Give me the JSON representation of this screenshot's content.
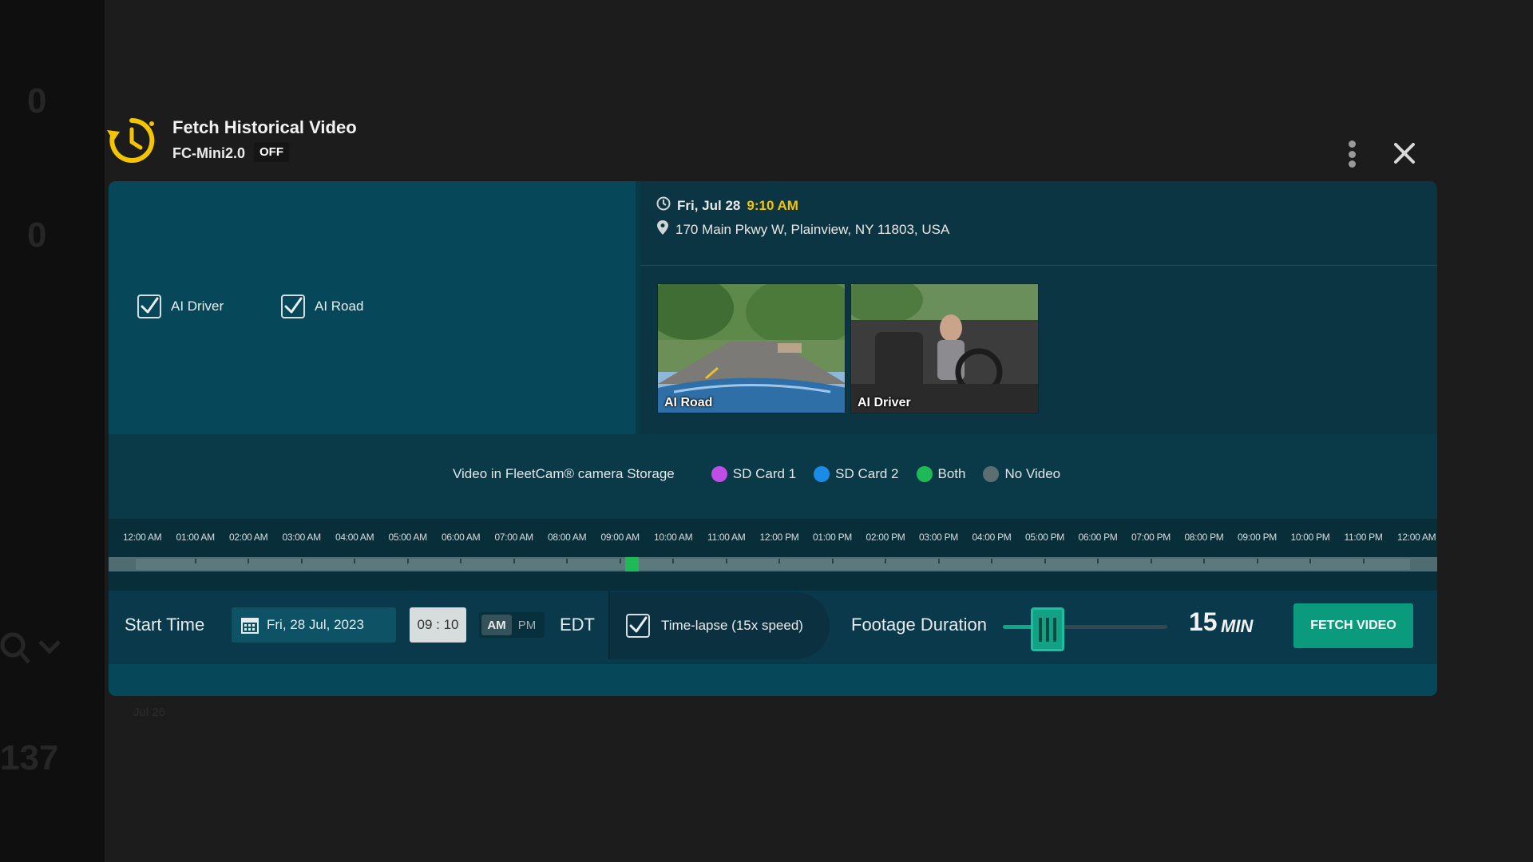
{
  "background": {
    "counters": [
      "0",
      "0"
    ],
    "lower_number": "137",
    "date_label": "Jul 26"
  },
  "dialog": {
    "title": "Fetch Historical Video",
    "device_name": "FC-Mini2.0",
    "device_status": "OFF",
    "icons": {
      "title": "history-clock-icon",
      "menu": "kebab-menu-icon",
      "close": "close-icon"
    }
  },
  "cameras": [
    {
      "label": "AI Driver",
      "checked": true
    },
    {
      "label": "AI Road",
      "checked": true
    }
  ],
  "info": {
    "date": "Fri, Jul 28",
    "time": "9:10 AM",
    "address": "170 Main Pkwy W, Plainview, NY 11803, USA"
  },
  "thumbnails": [
    {
      "label": "AI Road"
    },
    {
      "label": "AI Driver"
    }
  ],
  "legend": {
    "title": "Video in FleetCam® camera Storage",
    "items": [
      {
        "label": "SD Card 1",
        "color": "#c04de8"
      },
      {
        "label": "SD Card 2",
        "color": "#1a8ce8"
      },
      {
        "label": "Both",
        "color": "#1fba58"
      },
      {
        "label": "No Video",
        "color": "#5c6e72"
      }
    ]
  },
  "timeline": {
    "labels": [
      "12:00 AM",
      "01:00 AM",
      "02:00 AM",
      "03:00 AM",
      "04:00 AM",
      "05:00 AM",
      "06:00 AM",
      "07:00 AM",
      "08:00 AM",
      "09:00 AM",
      "10:00 AM",
      "11:00 AM",
      "12:00 PM",
      "01:00 PM",
      "02:00 PM",
      "03:00 PM",
      "04:00 PM",
      "05:00 PM",
      "06:00 PM",
      "07:00 PM",
      "08:00 PM",
      "09:00 PM",
      "10:00 PM",
      "11:00 PM",
      "12:00 AM"
    ],
    "video_segments": [
      {
        "start_hour": 9.1,
        "end_hour": 9.35,
        "storage": "Both"
      }
    ]
  },
  "controls": {
    "start_time_label": "Start Time",
    "date_value": "Fri, 28 Jul, 2023",
    "time_value": "09 : 10",
    "am_label": "AM",
    "pm_label": "PM",
    "ampm_selected": "AM",
    "timezone": "EDT",
    "timelapse_label": "Time-lapse (15x speed)",
    "timelapse_checked": true,
    "footage_label": "Footage Duration",
    "duration_value": "15",
    "duration_unit": "MIN",
    "duration_slider_fraction": 0.27,
    "fetch_label": "FETCH VIDEO"
  },
  "colors": {
    "accent_yellow": "#f5c400",
    "primary_button": "#0a9a7c",
    "panel_bg": "#063a48"
  }
}
